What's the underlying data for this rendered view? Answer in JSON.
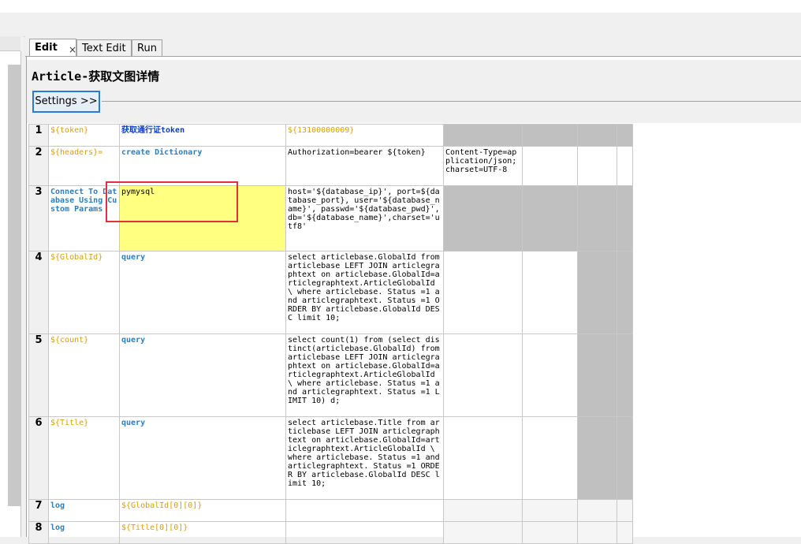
{
  "tabs": [
    {
      "label": "Edit",
      "close": "×"
    },
    {
      "label": "Text Edit"
    },
    {
      "label": "Run"
    }
  ],
  "page": {
    "title": "Article-获取文图详情",
    "settings_label": "Settings >>"
  },
  "rows": [
    {
      "num": "1",
      "c1": "${token}",
      "c2": "获取通行证token",
      "c3": "${13100000009}",
      "c4": ""
    },
    {
      "num": "2",
      "c1": "${headers}=",
      "c2": "create Dictionary",
      "c3": "Authorization=bearer ${token}",
      "c4": "Content-Type=application/json;charset=UTF-8"
    },
    {
      "num": "3",
      "c1": "Connect To Database Using Custom Params",
      "c2": "pymysql",
      "c3": "host='${database_ip}', port=${database_port}, user='${database_name}', passwd='${database_pwd}', db='${database_name}',charset='utf8'",
      "c4": ""
    },
    {
      "num": "4",
      "c1": "${GlobalId}",
      "c2": "query",
      "c3": "select articlebase.GlobalId from articlebase LEFT JOIN articlegraphtext on articlebase.GlobalId=articlegraphtext.ArticleGlobalId \\ where articlebase. Status =1 and articlegraphtext. Status =1 ORDER BY articlebase.GlobalId DESC limit 10;",
      "c4": ""
    },
    {
      "num": "5",
      "c1": "${count}",
      "c2": "query",
      "c3": "select count(1) from (select distinct(articlebase.GlobalId) from articlebase LEFT JOIN articlegraphtext on articlebase.GlobalId=articlegraphtext.ArticleGlobalId \\ where articlebase. Status =1 and articlegraphtext. Status =1 LIMIT 10) d;",
      "c4": ""
    },
    {
      "num": "6",
      "c1": "${Title}",
      "c2": "query",
      "c3": "select articlebase.Title from articlebase LEFT JOIN articlegraphtext on articlebase.GlobalId=articlegraphtext.ArticleGlobalId \\ where articlebase. Status =1 and articlegraphtext. Status =1 ORDER BY articlebase.GlobalId DESC limit 10;",
      "c4": ""
    },
    {
      "num": "7",
      "c1": "log",
      "c2": "${GlobalId[0][0]}",
      "c3": "",
      "c4": ""
    },
    {
      "num": "8",
      "c1": "log",
      "c2": "${Title[0][0]}",
      "c3": "",
      "c4": ""
    }
  ]
}
